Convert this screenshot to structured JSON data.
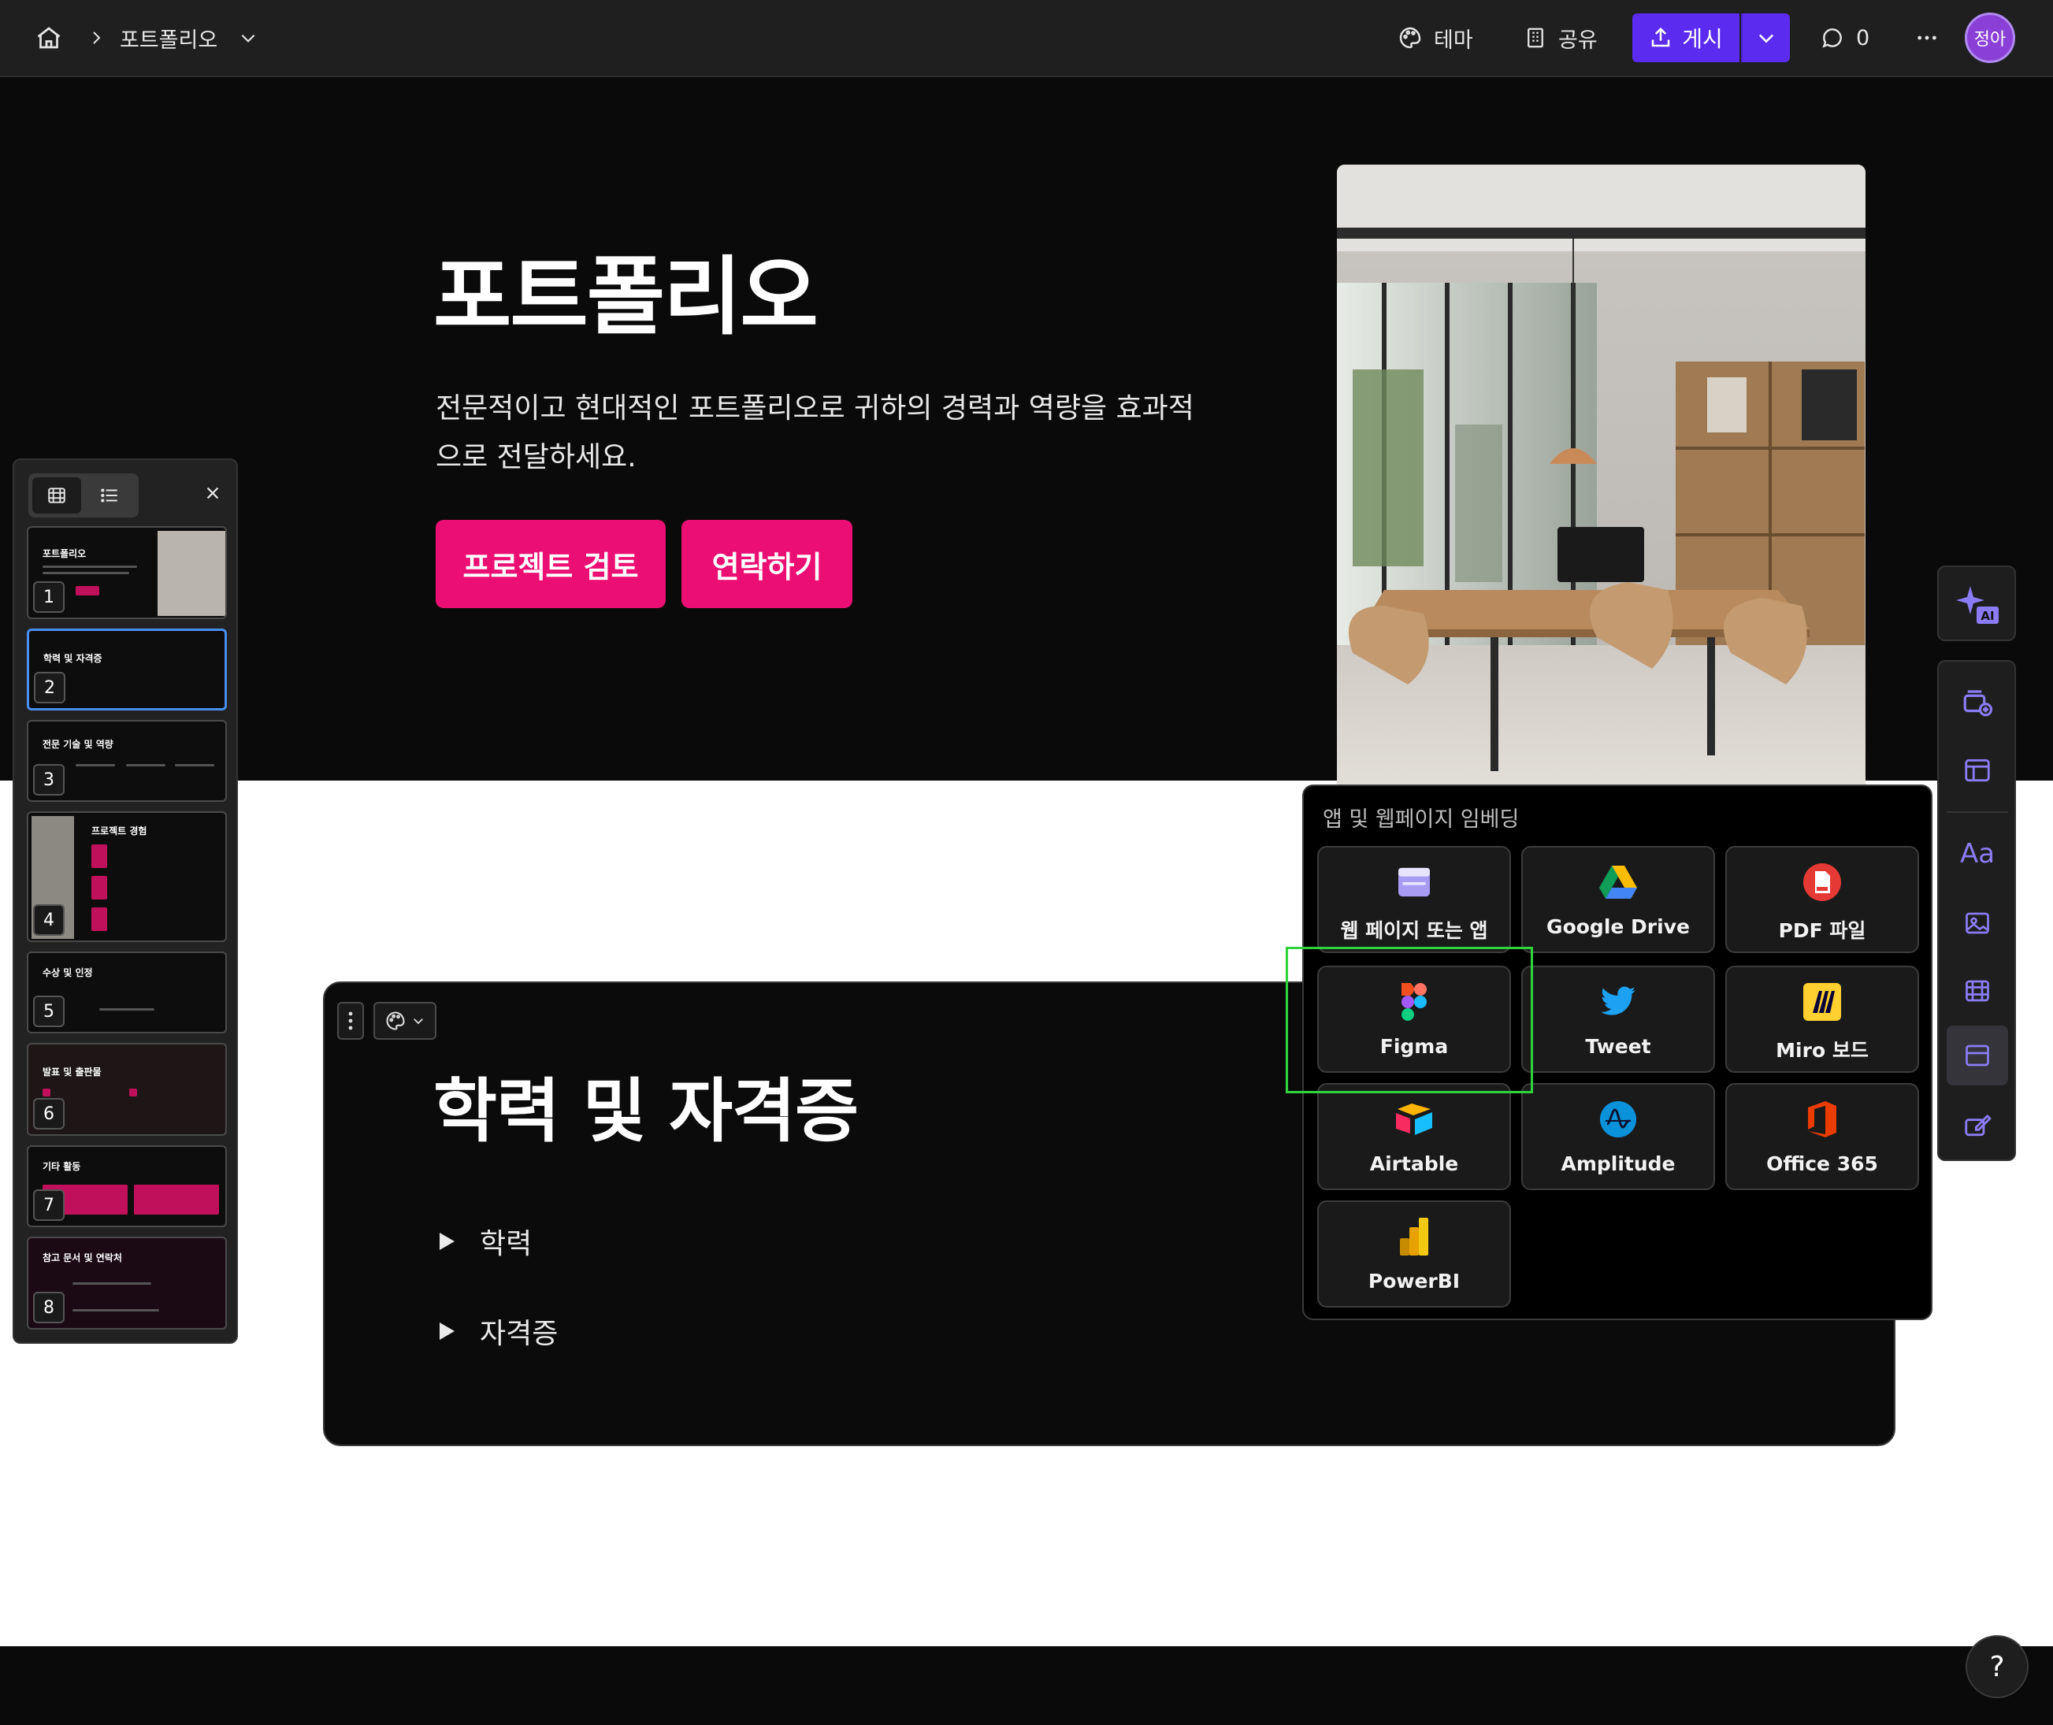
{
  "topbar": {
    "breadcrumb": "포트폴리오",
    "theme_label": "테마",
    "share_label": "공유",
    "publish_label": "게시",
    "comment_count": "0",
    "avatar_initials": "정아"
  },
  "hero": {
    "title": "포트폴리오",
    "description": "전문적이고 현대적인 포트폴리오로 귀하의 경력과 역량을 효과적으로 전달하세요.",
    "primary_button": "프로젝트 검토",
    "secondary_button": "연락하기"
  },
  "section2": {
    "title": "학력 및 자격증",
    "toggles": [
      {
        "label": "학력"
      },
      {
        "label": "자격증"
      }
    ]
  },
  "slide_panel": {
    "slides": [
      {
        "num": "1",
        "title": "포트폴리오"
      },
      {
        "num": "2",
        "title": "학력 및 자격증"
      },
      {
        "num": "3",
        "title": "전문 기술 및 역량"
      },
      {
        "num": "4",
        "title": "프로젝트 경험"
      },
      {
        "num": "5",
        "title": "수상 및 인정"
      },
      {
        "num": "6",
        "title": "발표 및 출판물"
      },
      {
        "num": "7",
        "title": "기타 활동"
      },
      {
        "num": "8",
        "title": "참고 문서 및 연락처"
      }
    ]
  },
  "embed_popover": {
    "title": "앱 및 웹페이지 임베딩",
    "items": [
      {
        "label": "웹 페이지 또는 앱",
        "icon": "web-app-icon"
      },
      {
        "label": "Google Drive",
        "icon": "google-drive-icon"
      },
      {
        "label": "PDF 파일",
        "icon": "pdf-icon"
      },
      {
        "label": "Figma",
        "icon": "figma-icon"
      },
      {
        "label": "Tweet",
        "icon": "twitter-icon"
      },
      {
        "label": "Miro 보드",
        "icon": "miro-icon"
      },
      {
        "label": "Airtable",
        "icon": "airtable-icon"
      },
      {
        "label": "Amplitude",
        "icon": "amplitude-icon"
      },
      {
        "label": "Office 365",
        "icon": "office-icon"
      },
      {
        "label": "PowerBI",
        "icon": "powerbi-icon"
      }
    ]
  },
  "rail": {
    "ai_badge": "AI",
    "text_tool": "Aa"
  },
  "help_label": "?",
  "colors": {
    "accent_pink": "#ec0f73",
    "publish_purple": "#5b2bf0",
    "selection_blue": "#4a8ef0",
    "highlight_green": "#2fd43a"
  }
}
